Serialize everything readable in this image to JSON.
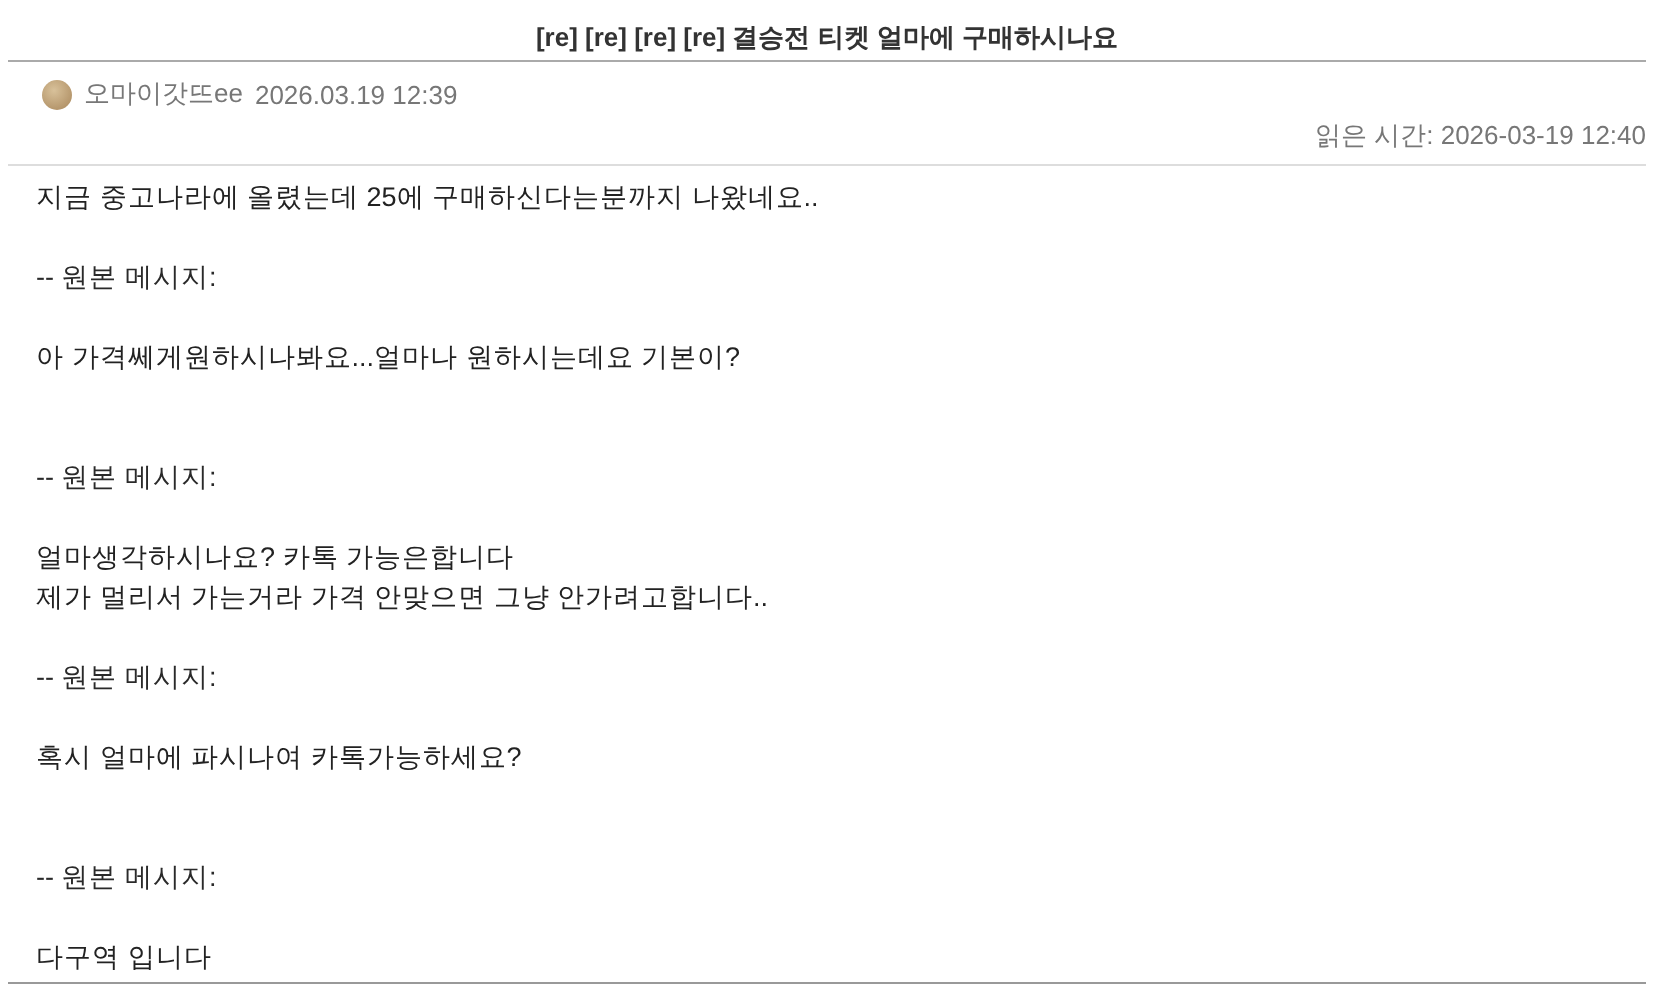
{
  "title": "[re] [re] [re] [re] 결승전 티켓 얼마에 구매하시나요",
  "sender": {
    "name": "오마이갓뜨ee",
    "sent": "2026.03.19 12:39"
  },
  "read_time": "읽은 시간: 2026-03-19 12:40",
  "body": [
    {
      "kind": "text",
      "lines": [
        "지금 중고나라에 올렸는데 25에 구매하신다는분까지 나왔네요.."
      ]
    },
    {
      "kind": "separator",
      "lines": [
        "-- 원본 메시지:"
      ]
    },
    {
      "kind": "text",
      "lines": [
        "아 가격쎄게원하시나봐요...얼마나 원하시는데요 기본이?"
      ]
    },
    {
      "kind": "separator",
      "lines": [
        "-- 원본 메시지:"
      ]
    },
    {
      "kind": "text",
      "lines": [
        "얼마생각하시나요? 카톡 가능은합니다",
        "제가 멀리서 가는거라 가격 안맞으면 그냥 안가려고합니다.."
      ]
    },
    {
      "kind": "separator",
      "lines": [
        "-- 원본 메시지:"
      ]
    },
    {
      "kind": "text",
      "lines": [
        "혹시 얼마에 파시나여 카톡가능하세요?"
      ]
    },
    {
      "kind": "separator",
      "lines": [
        "-- 원본 메시지:"
      ]
    },
    {
      "kind": "text",
      "lines": [
        "다구역 입니다"
      ]
    }
  ]
}
